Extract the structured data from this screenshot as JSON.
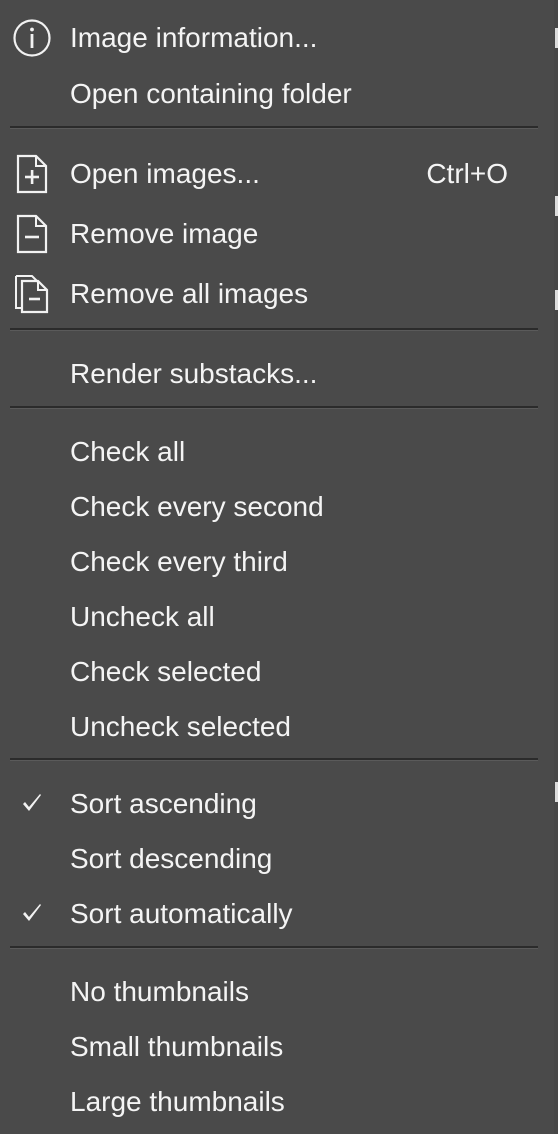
{
  "menu": {
    "items": [
      {
        "label": "Image information...",
        "icon": "info-icon"
      },
      {
        "label": "Open containing folder"
      },
      {
        "label": "Open images...",
        "shortcut": "Ctrl+O",
        "icon": "file-add-icon"
      },
      {
        "label": "Remove image",
        "icon": "file-remove-icon"
      },
      {
        "label": "Remove all images",
        "icon": "files-remove-icon"
      },
      {
        "label": "Render substacks..."
      },
      {
        "label": "Check all"
      },
      {
        "label": "Check every second"
      },
      {
        "label": "Check every third"
      },
      {
        "label": "Uncheck all"
      },
      {
        "label": "Check selected"
      },
      {
        "label": "Uncheck selected"
      },
      {
        "label": "Sort ascending",
        "checked": true,
        "icon": "checkmark-icon"
      },
      {
        "label": "Sort descending",
        "checked": false
      },
      {
        "label": "Sort automatically",
        "checked": true,
        "icon": "checkmark-icon"
      },
      {
        "label": "No thumbnails"
      },
      {
        "label": "Small thumbnails"
      },
      {
        "label": "Large thumbnails"
      }
    ]
  },
  "colors": {
    "background": "#4a4a4a",
    "text": "#f4f4f4",
    "separator": "#2b2b2b"
  }
}
